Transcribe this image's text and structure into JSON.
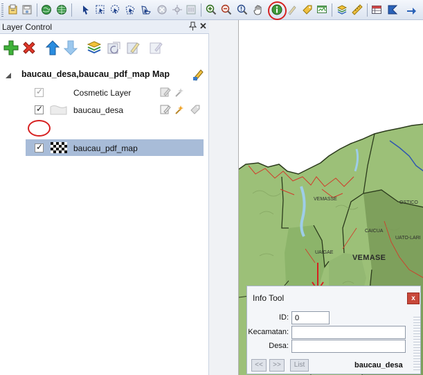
{
  "toolbar": {
    "icons": [
      "open-project-icon",
      "save-icon",
      "globe-icon",
      "grid-globe-icon",
      "select-arrow-icon",
      "marquee-select-icon",
      "lasso-select-icon",
      "polygon-select-icon",
      "zoom-layer-icon",
      "reshape-icon",
      "move-node-icon",
      "info-frame-icon",
      "zoom-in-icon",
      "zoom-out-icon",
      "zoom-extent-icon",
      "pan-hand-icon",
      "info-tool-icon",
      "label-icon",
      "tag-icon",
      "hotlink-icon",
      "layers-icon",
      "ruler-icon",
      "table-icon",
      "statistics-icon",
      "arrow-icon"
    ]
  },
  "layer_control": {
    "title": "Layer Control",
    "pin_glyph": "⌂",
    "close_glyph": "✕",
    "buttons": [
      "add-layer-icon",
      "remove-layer-icon",
      "move-up-icon",
      "move-down-icon",
      "layer-properties-icon",
      "reload-icon",
      "style-icon",
      "edit-icon"
    ],
    "map_name": "baucau_desa,baucau_pdf_map Map",
    "layers": [
      {
        "name": "Cosmetic Layer",
        "checked": true,
        "dimmed": true
      },
      {
        "name": "baucau_desa",
        "checked": true,
        "dimmed": false
      },
      {
        "name": "baucau_pdf_map",
        "checked": true,
        "dimmed": false,
        "selected": true
      }
    ]
  },
  "map": {
    "labels": [
      "VEMASSE",
      "OSTICO",
      "CAICUA",
      "UATO-LARI",
      "UAIGAE",
      "VEMASE"
    ],
    "colors": {
      "land": "#9cc078",
      "boundary": "#2b3a1c",
      "road": "#d23a2a",
      "water": "#9ecde8",
      "river": "#2f56b0"
    }
  },
  "info_tool": {
    "title": "Info Tool",
    "close_glyph": "x",
    "fields": [
      {
        "label": "ID:",
        "value": "0"
      },
      {
        "label": "Kecamatan:",
        "value": ""
      },
      {
        "label": "Desa:",
        "value": ""
      }
    ],
    "nav": {
      "prev": "<<",
      "next": ">>",
      "list": "List"
    },
    "layer_name": "baucau_desa"
  },
  "annotation_color": "#d62020"
}
